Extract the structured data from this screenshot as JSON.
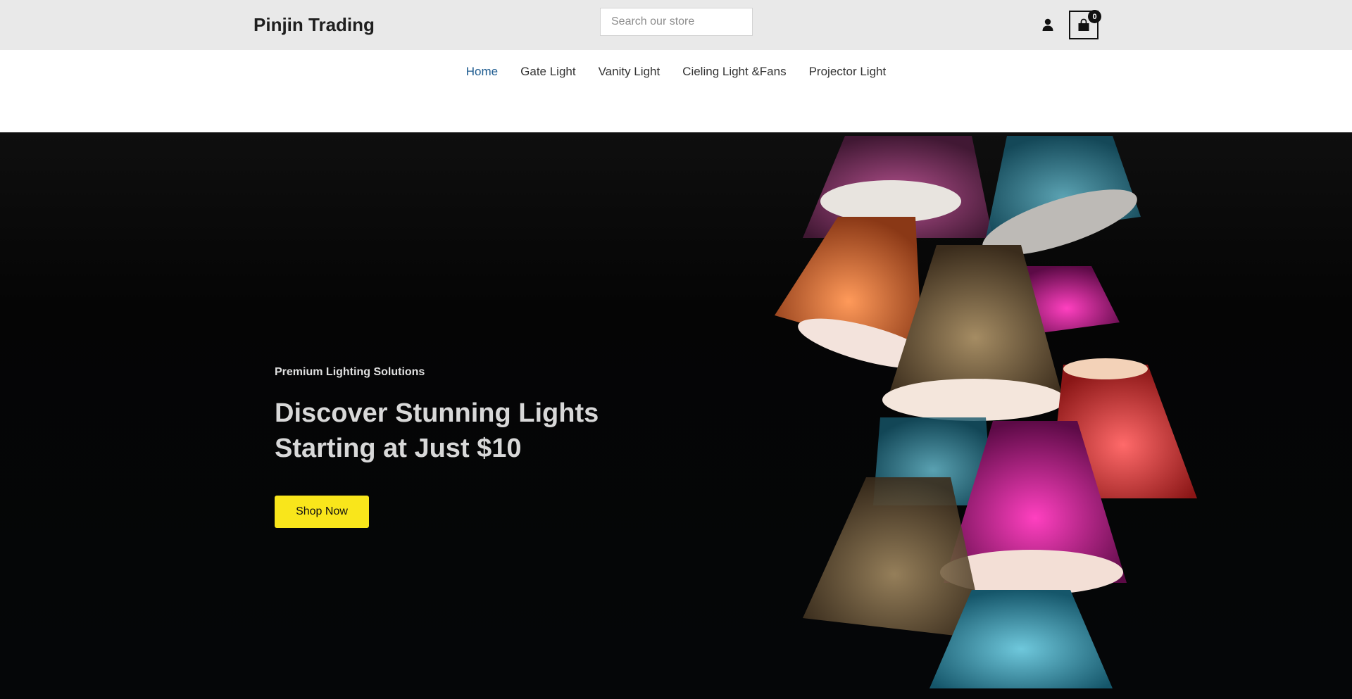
{
  "header": {
    "brand": "Pinjin Trading",
    "search_placeholder": "Search our store",
    "user_icon": "user-icon",
    "cart_icon": "shopping-bag-icon",
    "cart_count": "0"
  },
  "nav": {
    "items": [
      {
        "label": "Home",
        "active": true
      },
      {
        "label": "Gate Light"
      },
      {
        "label": "Vanity Light"
      },
      {
        "label": "Cieling Light &Fans"
      },
      {
        "label": "Projector Light"
      }
    ]
  },
  "hero": {
    "subtitle": "Premium Lighting Solutions",
    "title_line1": "Discover Stunning Lights",
    "title_line2": "Starting at Just $10",
    "cta_label": "Shop Now",
    "cta_color": "#f9e61b",
    "background_color": "#050608",
    "image": "colorful-lamp-shades-image"
  },
  "colors": {
    "topbar": "#e9e9e9",
    "nav_active": "#1c5a8f",
    "text": "#333333"
  }
}
